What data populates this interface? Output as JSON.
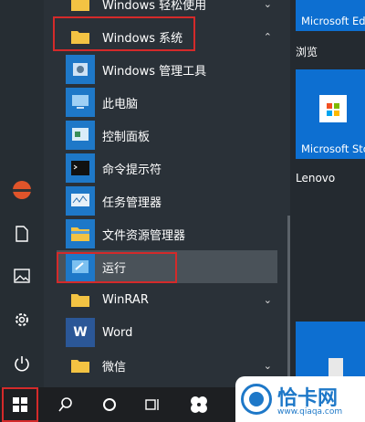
{
  "start_menu": {
    "apps": [
      {
        "label": "Windows 轻松使用",
        "chevron": "⌄"
      },
      {
        "label": "Windows 系统",
        "chevron": "⌃"
      },
      {
        "label": "Windows 管理工具"
      },
      {
        "label": "此电脑"
      },
      {
        "label": "控制面板"
      },
      {
        "label": "命令提示符"
      },
      {
        "label": "任务管理器"
      },
      {
        "label": "文件资源管理器"
      },
      {
        "label": "运行"
      },
      {
        "label": "WinRAR",
        "chevron": "⌄"
      },
      {
        "label": "Word"
      },
      {
        "label": "微信",
        "chevron": "⌄"
      }
    ],
    "word_tile_letter": "W"
  },
  "tiles": {
    "edge_label": "Microsoft Edge",
    "browse_label": "浏览",
    "store_label": "Microsoft Store",
    "lenovo_label": "Lenovo"
  },
  "taskbar": {
    "icons": [
      "windows-start-icon",
      "search-icon",
      "cortana-icon",
      "task-view-icon",
      "pinwheel-icon"
    ]
  },
  "watermark": {
    "text": "恰卡网",
    "url": "www.qiaqa.com"
  },
  "colors": {
    "accent": "#1e78c8",
    "highlight": "#d42a2a",
    "background": "#2a3138"
  }
}
